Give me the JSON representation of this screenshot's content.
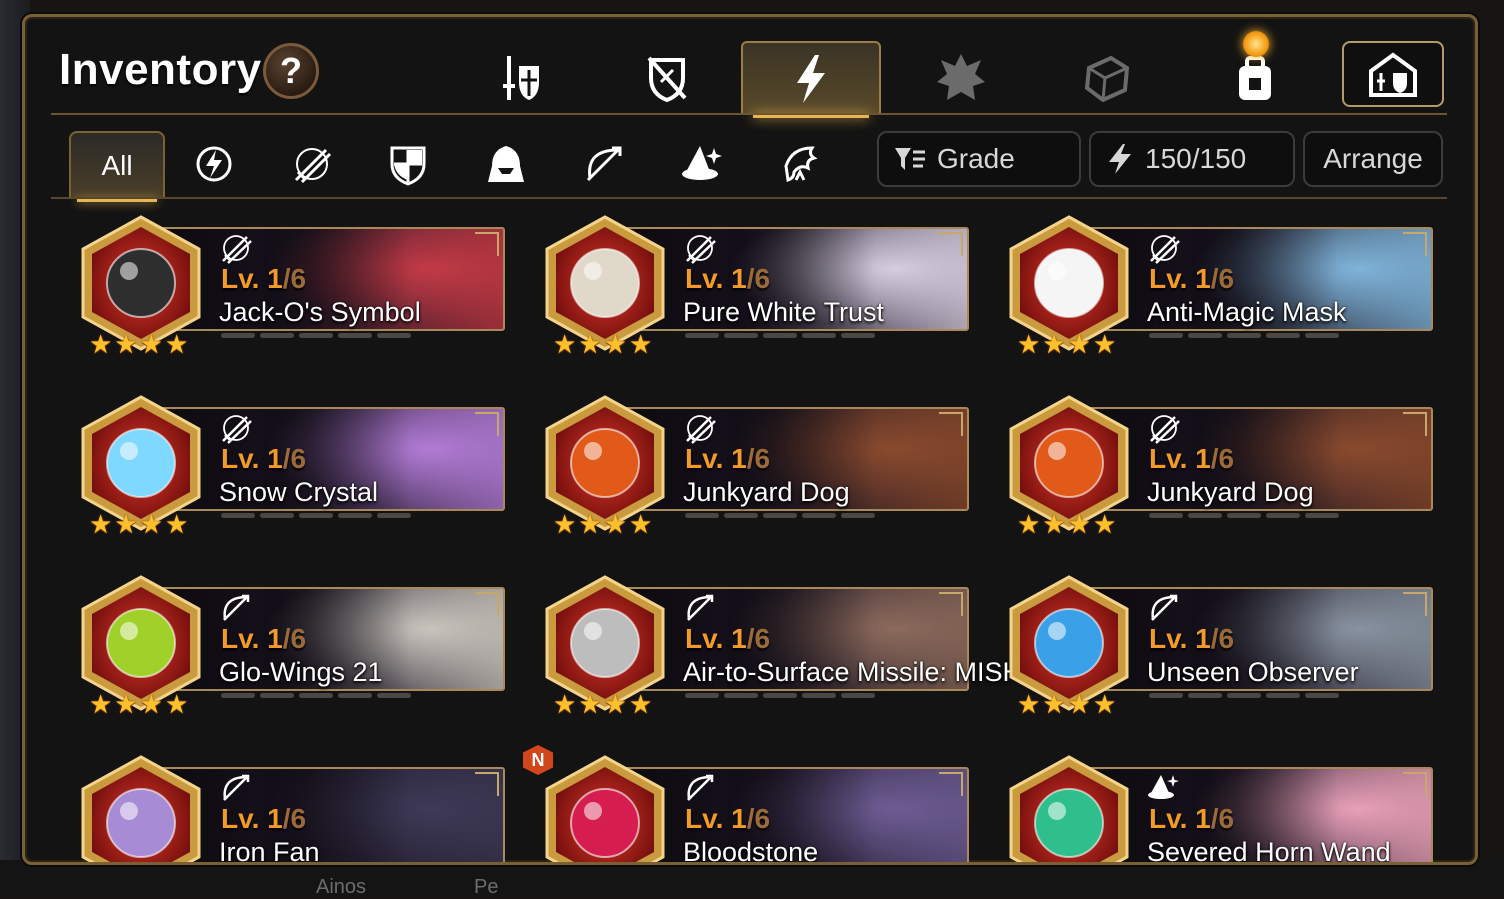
{
  "header": {
    "title": "Inventory",
    "help_label": "?"
  },
  "main_tabs": [
    {
      "name": "tab-weapon",
      "icon": "sword-shield-icon",
      "active": false
    },
    {
      "name": "tab-armor",
      "icon": "broken-shield-icon",
      "active": false
    },
    {
      "name": "tab-artifact",
      "icon": "lightning-icon",
      "active": true
    },
    {
      "name": "tab-catalyst",
      "icon": "crest-icon",
      "active": false
    },
    {
      "name": "tab-material",
      "icon": "cube-icon",
      "active": false
    },
    {
      "name": "tab-consumable",
      "icon": "bag-icon",
      "active": false
    }
  ],
  "filters": {
    "all_label": "All",
    "class_icons": [
      "soul-weaver-icon",
      "warrior-icon",
      "knight-icon",
      "thief-icon",
      "ranger-icon",
      "mage-icon",
      "knight-bird-icon"
    ],
    "grade_label": "Grade",
    "capacity_label": "150/150",
    "arrange_label": "Arrange"
  },
  "items": [
    {
      "name": "Jack-O's Symbol",
      "level": "Lv. 1",
      "max": "/6",
      "class": "warrior",
      "stars": 4,
      "gem": "#2e2e2e",
      "art": "#c23a46",
      "new": false
    },
    {
      "name": "Pure White Trust",
      "level": "Lv. 1",
      "max": "/6",
      "class": "warrior",
      "stars": 4,
      "gem": "#e0d8c8",
      "art": "#d7cde0",
      "new": false
    },
    {
      "name": "Anti-Magic Mask",
      "level": "Lv. 1",
      "max": "/6",
      "class": "warrior",
      "stars": 4,
      "gem": "#f5f5f5",
      "art": "#7fb3d9",
      "new": false
    },
    {
      "name": "Snow Crystal",
      "level": "Lv. 1",
      "max": "/6",
      "class": "warrior",
      "stars": 4,
      "gem": "#7fd8ff",
      "art": "#b27bd6",
      "new": false
    },
    {
      "name": "Junkyard Dog",
      "level": "Lv. 1",
      "max": "/6",
      "class": "warrior",
      "stars": 4,
      "gem": "#e25a1a",
      "art": "#8a4a2e",
      "new": false
    },
    {
      "name": "Junkyard Dog",
      "level": "Lv. 1",
      "max": "/6",
      "class": "warrior",
      "stars": 4,
      "gem": "#e25a1a",
      "art": "#8a4a2e",
      "new": false
    },
    {
      "name": "Glo-Wings 21",
      "level": "Lv. 1",
      "max": "/6",
      "class": "ranger",
      "stars": 4,
      "gem": "#9fd12a",
      "art": "#c9c4bd",
      "new": false
    },
    {
      "name": "Air-to-Surface Missile: MISHA",
      "level": "Lv. 1",
      "max": "/6",
      "class": "ranger",
      "stars": 4,
      "gem": "#bdbdbd",
      "art": "#8c6a5c",
      "new": false
    },
    {
      "name": "Unseen Observer",
      "level": "Lv. 1",
      "max": "/6",
      "class": "ranger",
      "stars": 4,
      "gem": "#3aa1e8",
      "art": "#8892a0",
      "new": false
    },
    {
      "name": "Iron Fan",
      "level": "Lv. 1",
      "max": "/6",
      "class": "ranger",
      "stars": 4,
      "gem": "#a78bd4",
      "art": "#3e3a57",
      "new": false
    },
    {
      "name": "Bloodstone",
      "level": "Lv. 1",
      "max": "/6",
      "class": "ranger",
      "stars": 4,
      "gem": "#d51e4f",
      "art": "#6d5c94",
      "new": true,
      "new_label": "N"
    },
    {
      "name": "Severed Horn Wand",
      "level": "Lv. 1",
      "max": "/6",
      "class": "mage",
      "stars": 4,
      "gem": "#2fbf8c",
      "art": "#e8a0b8",
      "new": false
    }
  ],
  "background_text": {
    "bottom_left": "Ainos",
    "bottom_mid": "Pe"
  },
  "colors": {
    "accent_gold": "#c9a25e",
    "level_orange": "#f39a2b",
    "star_yellow": "#ffc02c"
  }
}
